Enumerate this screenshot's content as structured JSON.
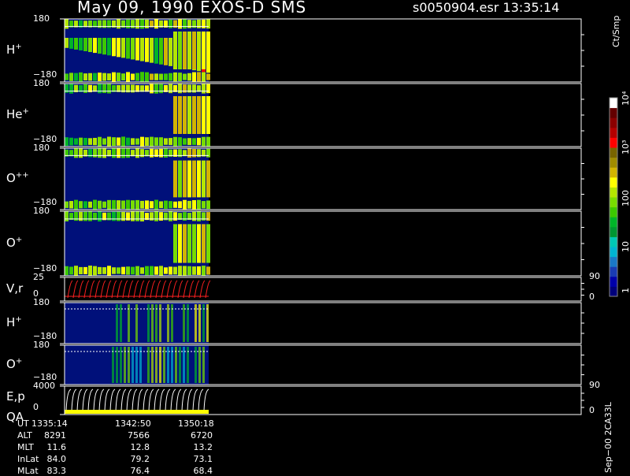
{
  "header": {
    "title": "May 09, 1990   EXOS-D SMS",
    "file_time": "s0050904.esr  13:35:14"
  },
  "chart_data": {
    "type": "heatmap",
    "panels": [
      {
        "label": "H",
        "sup": "+",
        "yticks": [
          "180",
          "−180"
        ]
      },
      {
        "label": "He",
        "sup": "+",
        "yticks": [
          "180",
          "−180"
        ]
      },
      {
        "label": "O",
        "sup": "++",
        "yticks": [
          "180",
          "−180"
        ]
      },
      {
        "label": "O",
        "sup": "+",
        "yticks": [
          "180",
          "−180"
        ]
      },
      {
        "label": "V,r",
        "sup": "",
        "yticks": [
          "25",
          "0"
        ],
        "right_ticks": [
          "90",
          "0"
        ]
      },
      {
        "label": "H",
        "sup": "+",
        "yticks": [
          "180",
          "−180"
        ]
      },
      {
        "label": "O",
        "sup": "+",
        "yticks": [
          "180",
          "−180"
        ]
      },
      {
        "label": "E,p",
        "sup": "",
        "label2": "QA",
        "yticks": [
          "4000",
          "0"
        ],
        "right_ticks": [
          "90",
          "0"
        ]
      }
    ],
    "colorbar": {
      "unit": "Ct/Smp",
      "labels": [
        "1",
        "10",
        "100",
        "10³",
        "10⁴"
      ],
      "colors": [
        "#00007a",
        "#0000aa",
        "#1a3cb4",
        "#1a78c8",
        "#00b4d2",
        "#00c8b4",
        "#009632",
        "#00b428",
        "#3cc800",
        "#78dc00",
        "#b4e600",
        "#ffff00",
        "#d2b400",
        "#a08c00",
        "#786400",
        "#ff0000",
        "#b40000",
        "#8c0000",
        "#640000",
        "#ffffff"
      ]
    },
    "footer": {
      "labels": [
        "UT",
        "ALT",
        "MLT",
        "InLat",
        "MLat"
      ],
      "columns": [
        [
          "1335:14",
          "8291",
          "11.6",
          "84.0",
          "83.3"
        ],
        [
          "1342:50",
          "7566",
          "12.8",
          "79.2",
          "76.4"
        ],
        [
          "1350:18",
          "6720",
          "13.2",
          "73.1",
          "68.4"
        ]
      ]
    },
    "side_note": "Sep−00  2CA33L"
  }
}
